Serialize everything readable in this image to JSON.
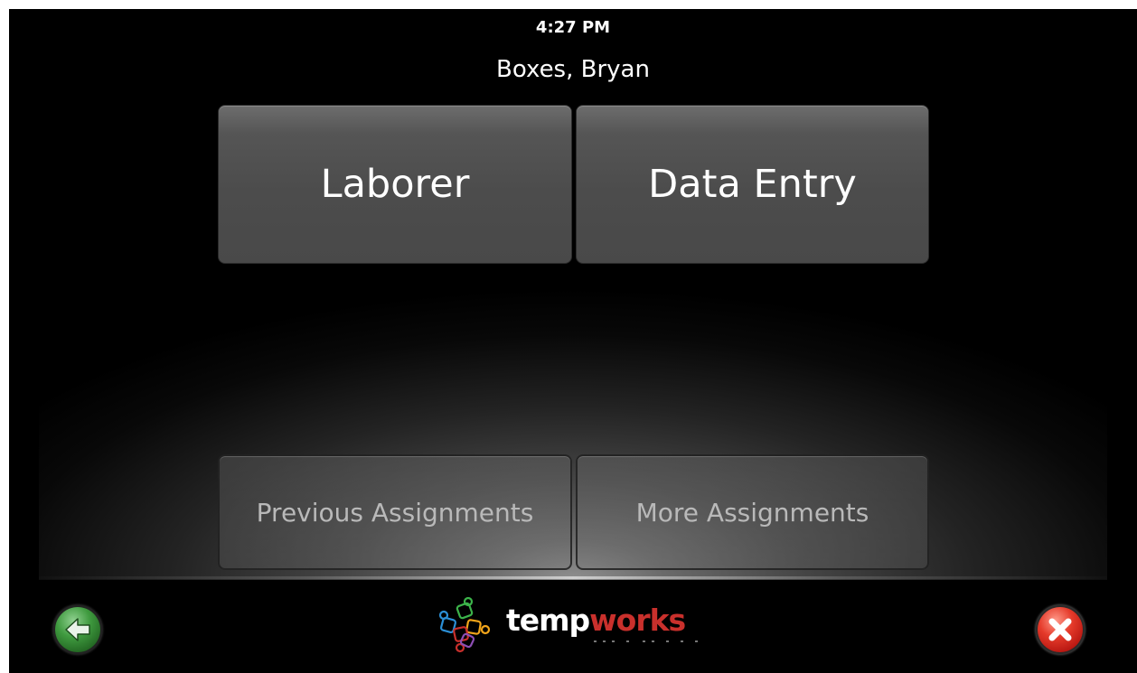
{
  "header": {
    "time": "4:27 PM",
    "employee_name": "Boxes, Bryan"
  },
  "assignments": {
    "items": [
      {
        "label": "Laborer"
      },
      {
        "label": "Data Entry"
      }
    ]
  },
  "actions": {
    "previous_label": "Previous Assignments",
    "more_label": "More Assignments"
  },
  "footer": {
    "logo_text_part1": "temp",
    "logo_text_part2": "works",
    "back_icon": "back-arrow-icon",
    "close_icon": "close-icon"
  },
  "colors": {
    "background": "#000000",
    "tile": "#4f4f4f",
    "brand_red": "#c9302c",
    "back_green": "#3f9a3f",
    "close_red": "#e53a2a"
  }
}
